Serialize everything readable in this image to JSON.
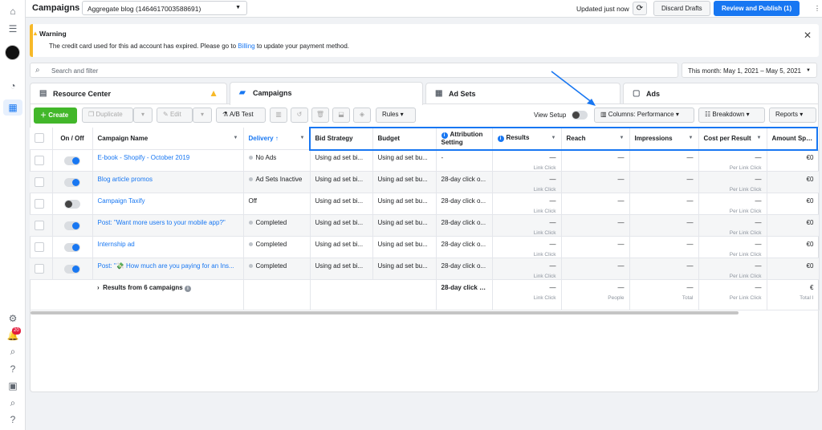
{
  "header": {
    "title": "Campaigns",
    "account": "Aggregate blog (1464617003588691)",
    "updated": "Updated just now",
    "discard": "Discard Drafts",
    "publish": "Review and Publish (1)"
  },
  "warning": {
    "title": "Warning",
    "body_pre": "The credit card used for this ad account has expired. Please go to ",
    "body_link": "Billing",
    "body_post": " to update your payment method."
  },
  "search": {
    "placeholder": "Search and filter"
  },
  "date_range": "This month: May 1, 2021 – May 5, 2021",
  "tabs": [
    {
      "label": "Resource Center"
    },
    {
      "label": "Campaigns"
    },
    {
      "label": "Ad Sets"
    },
    {
      "label": "Ads"
    }
  ],
  "toolbar": {
    "create": "Create",
    "duplicate": "Duplicate",
    "edit": "Edit",
    "ab_test": "A/B Test",
    "rules": "Rules",
    "view_setup": "View Setup",
    "columns": "Columns: Performance",
    "breakdown": "Breakdown",
    "reports": "Reports"
  },
  "notifications_count": "20",
  "table": {
    "headers": {
      "onoff": "On / Off",
      "name": "Campaign Name",
      "delivery": "Delivery ↑",
      "bid": "Bid Strategy",
      "budget": "Budget",
      "attribution": "Attribution Setting",
      "results": "Results",
      "reach": "Reach",
      "impressions": "Impressions",
      "cpr": "Cost per Result",
      "spent": "Amount Spent"
    },
    "rows": [
      {
        "name": "E-book - Shopify - October 2019",
        "delivery": "No Ads",
        "bid": "Using ad set bi...",
        "budget": "Using ad set bu...",
        "attribution": "-",
        "results": "—",
        "results_sub": "Link Click",
        "reach": "—",
        "impressions": "—",
        "cpr": "—",
        "cpr_sub": "Per Link Click",
        "spent": "€0",
        "on": true
      },
      {
        "name": "Blog article promos",
        "delivery": "Ad Sets Inactive",
        "bid": "Using ad set bi...",
        "budget": "Using ad set bu...",
        "attribution": "28-day click o...",
        "results": "—",
        "results_sub": "Link Click",
        "reach": "—",
        "impressions": "—",
        "cpr": "—",
        "cpr_sub": "Per Link Click",
        "spent": "€0",
        "on": true
      },
      {
        "name": "Campaign Taxify",
        "delivery": "Off",
        "bid": "Using ad set bi...",
        "budget": "Using ad set bu...",
        "attribution": "28-day click o...",
        "results": "—",
        "results_sub": "Link Click",
        "reach": "—",
        "impressions": "—",
        "cpr": "—",
        "cpr_sub": "Per Link Click",
        "spent": "€0",
        "on": false
      },
      {
        "name": "Post: \"Want more users to your mobile app?\"",
        "delivery": "Completed",
        "bid": "Using ad set bi...",
        "budget": "Using ad set bu...",
        "attribution": "28-day click o...",
        "results": "—",
        "results_sub": "Link Click",
        "reach": "—",
        "impressions": "—",
        "cpr": "—",
        "cpr_sub": "Per Link Click",
        "spent": "€0",
        "on": true
      },
      {
        "name": "Internship ad",
        "delivery": "Completed",
        "bid": "Using ad set bi...",
        "budget": "Using ad set bu...",
        "attribution": "28-day click o...",
        "results": "—",
        "results_sub": "Link Click",
        "reach": "—",
        "impressions": "—",
        "cpr": "—",
        "cpr_sub": "Per Link Click",
        "spent": "€0",
        "on": true
      },
      {
        "name": "Post: \"💸 How much are you paying for an Ins...",
        "delivery": "Completed",
        "bid": "Using ad set bi...",
        "budget": "Using ad set bu...",
        "attribution": "28-day click o...",
        "results": "—",
        "results_sub": "Link Click",
        "reach": "—",
        "impressions": "—",
        "cpr": "—",
        "cpr_sub": "Per Link Click",
        "spent": "€0",
        "on": true
      }
    ],
    "summary": {
      "label": "Results from 6 campaigns",
      "attribution": "28-day click o...",
      "results": "—",
      "results_sub": "Link Click",
      "reach": "—",
      "reach_sub": "People",
      "impressions": "—",
      "impressions_sub": "Total",
      "cpr": "—",
      "cpr_sub": "Per Link Click",
      "spent": "€",
      "spent_sub": "Total I"
    }
  },
  "colors": {
    "accent": "#1877f2",
    "create": "#42b72a",
    "warning": "#f7b928"
  }
}
